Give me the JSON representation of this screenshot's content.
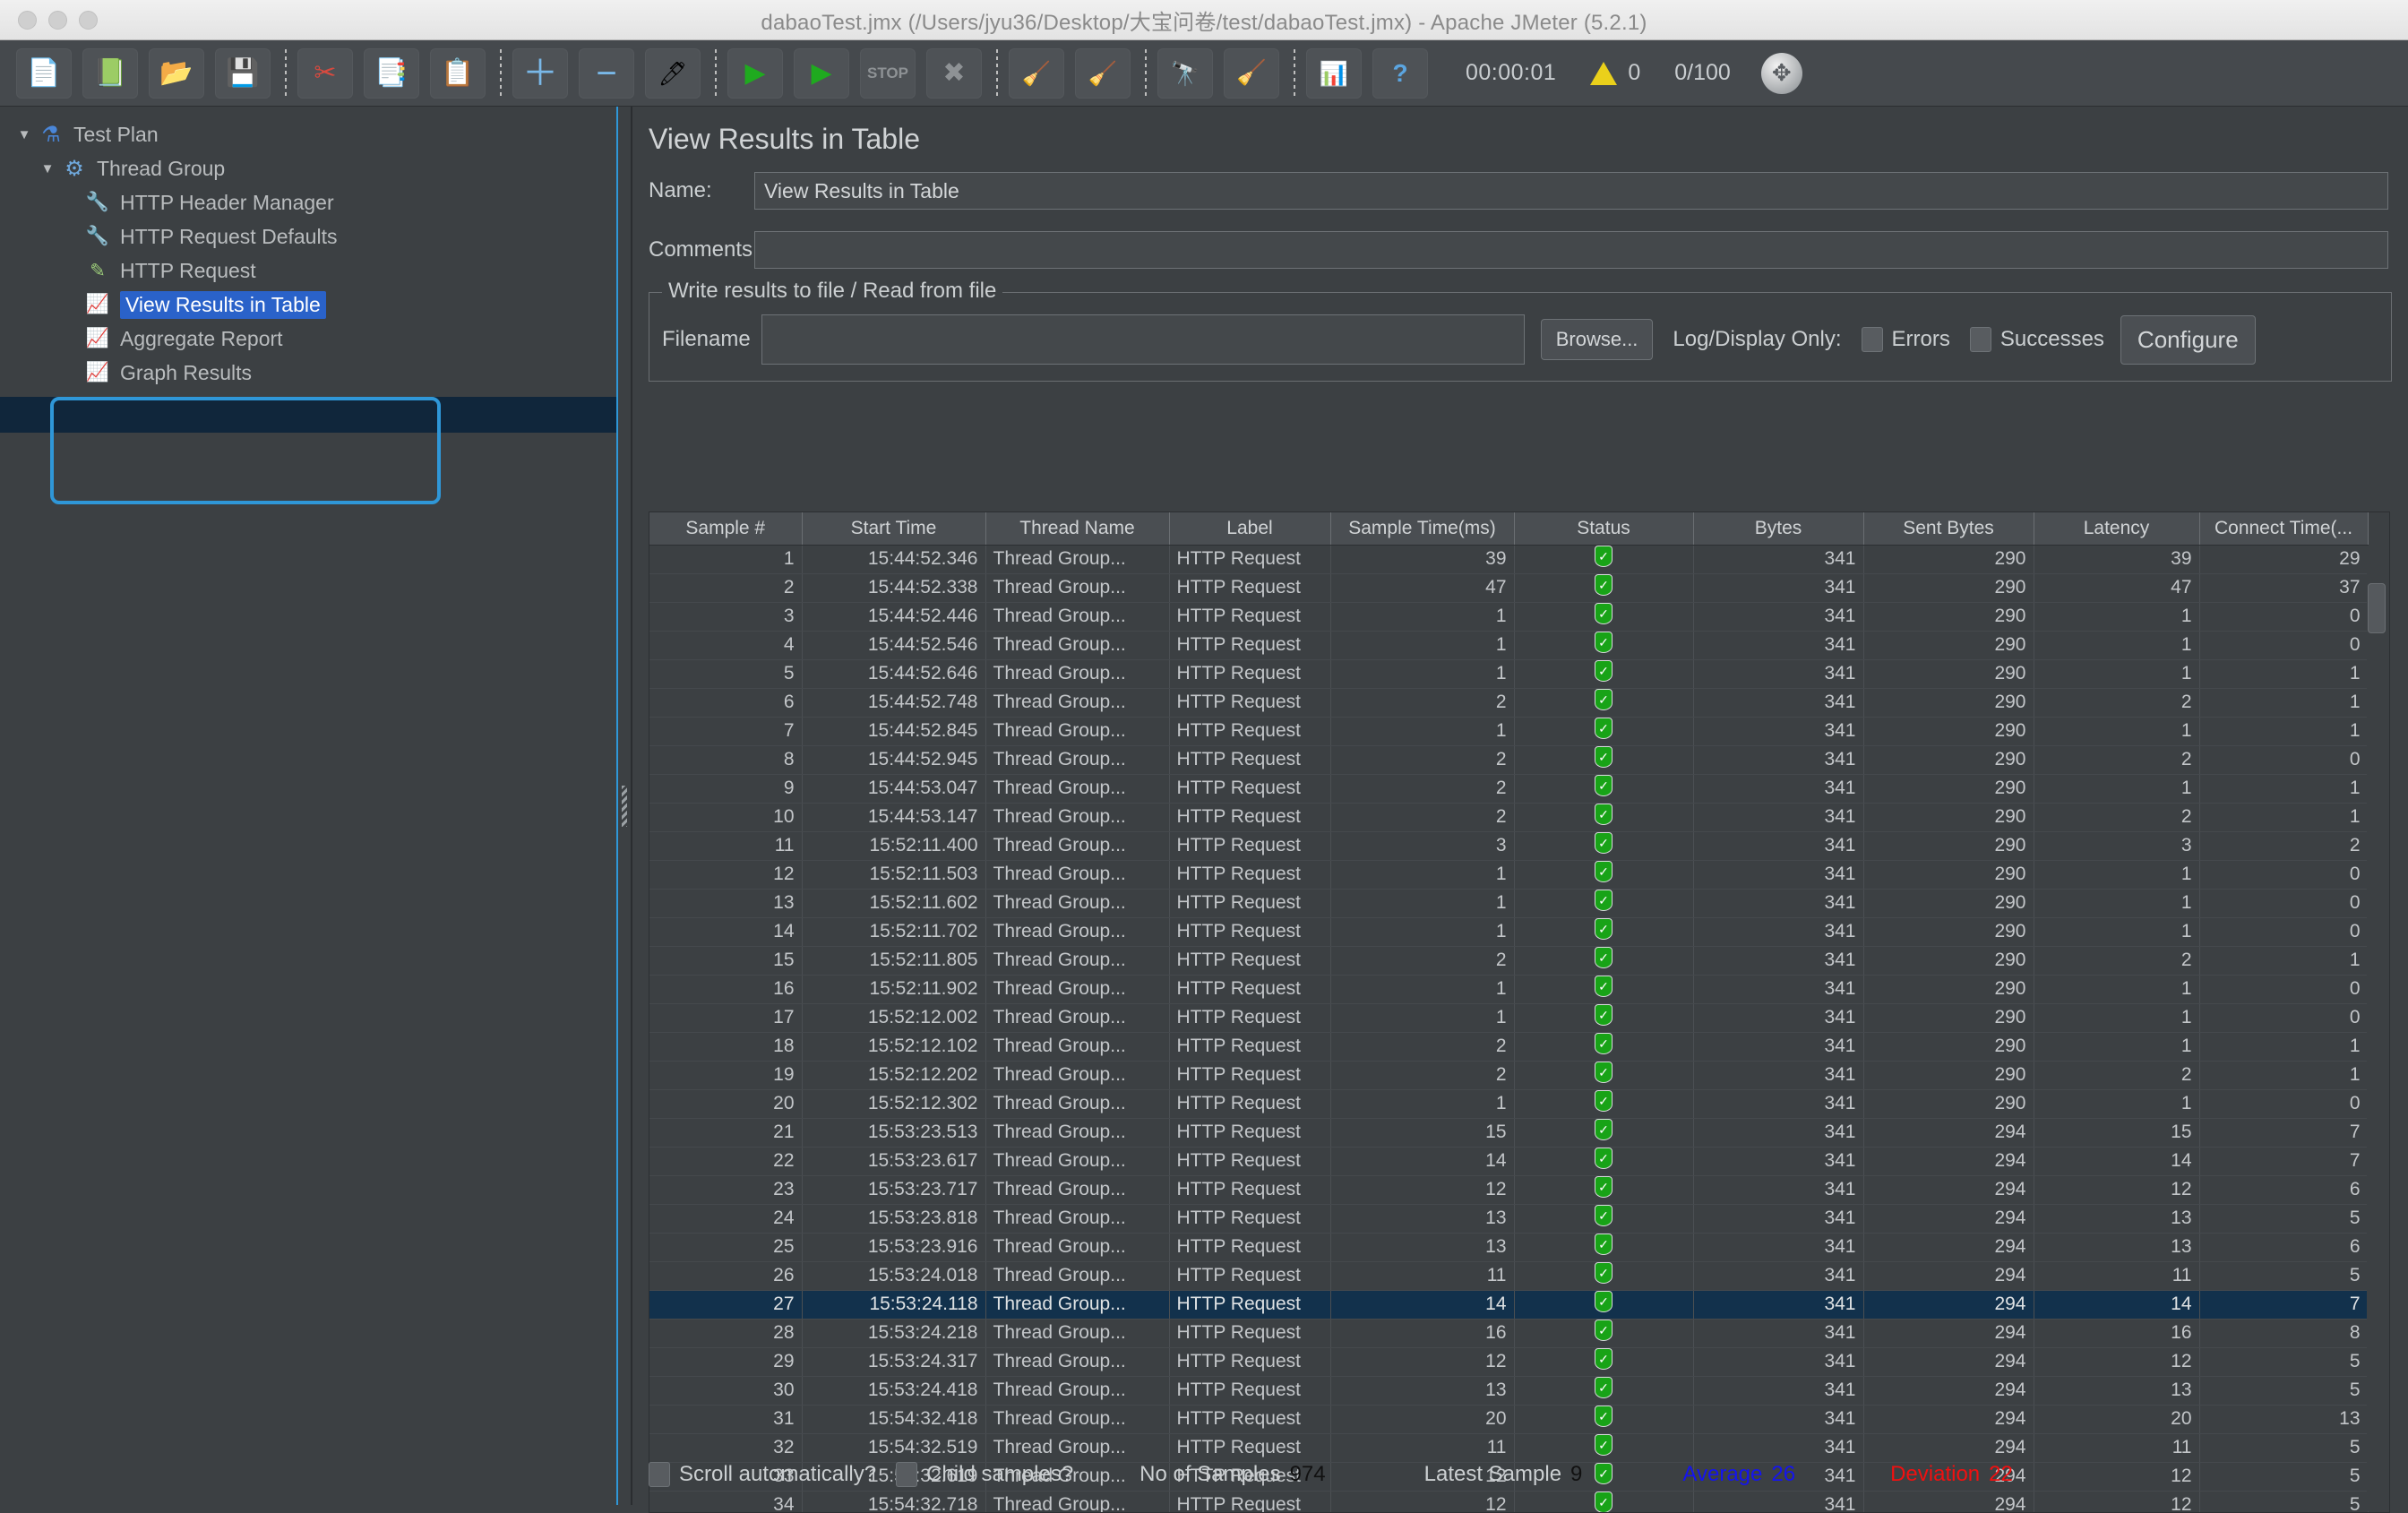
{
  "window": {
    "title": "dabaoTest.jmx (/Users/jyu36/Desktop/大宝问卷/test/dabaoTest.jmx) - Apache JMeter (5.2.1)"
  },
  "toolbar": {
    "buttons": [
      {
        "name": "new-test-plan",
        "icon": "📄",
        "label": "New"
      },
      {
        "name": "templates",
        "icon": "📗",
        "label": "Templates"
      },
      {
        "name": "open",
        "icon": "📂",
        "label": "Open"
      },
      {
        "name": "save",
        "icon": "💾",
        "label": "Save"
      },
      {
        "name": "cut",
        "icon": "✂",
        "label": "Cut"
      },
      {
        "name": "copy",
        "icon": "📑",
        "label": "Copy"
      },
      {
        "name": "paste",
        "icon": "📋",
        "label": "Paste"
      },
      {
        "name": "expand-all",
        "icon": "＋",
        "label": "Expand All"
      },
      {
        "name": "collapse-all",
        "icon": "−",
        "label": "Collapse All"
      },
      {
        "name": "toggle",
        "icon": "🖊",
        "label": "Toggle"
      },
      {
        "name": "start",
        "icon": "▶",
        "label": "Start"
      },
      {
        "name": "start-no-pauses",
        "icon": "▶",
        "label": "Start no pauses"
      },
      {
        "name": "stop",
        "icon": "STOP",
        "label": "Stop"
      },
      {
        "name": "shutdown",
        "icon": "✖",
        "label": "Shutdown"
      },
      {
        "name": "clear",
        "icon": "🧹",
        "label": "Clear"
      },
      {
        "name": "clear-all",
        "icon": "🧹",
        "label": "Clear All"
      },
      {
        "name": "search",
        "icon": "🔭",
        "label": "Search"
      },
      {
        "name": "reset-search",
        "icon": "🧹",
        "label": "Reset Search"
      },
      {
        "name": "function-helper",
        "icon": "📑",
        "label": "Function Helper Dialog"
      },
      {
        "name": "help",
        "icon": "?",
        "label": "Help"
      }
    ],
    "elapsed_time": "00:00:01",
    "warning_count": "0",
    "thread_counter": "0/100"
  },
  "tree": {
    "items": [
      {
        "label": "Test Plan",
        "icon": "flask-icon",
        "depth": 0,
        "expanded": true,
        "selected": false
      },
      {
        "label": "Thread Group",
        "icon": "gear-icon",
        "depth": 1,
        "expanded": true,
        "selected": false
      },
      {
        "label": "HTTP Header Manager",
        "icon": "tools-icon",
        "depth": 2,
        "expanded": false,
        "selected": false
      },
      {
        "label": "HTTP Request Defaults",
        "icon": "tools-icon",
        "depth": 2,
        "expanded": false,
        "selected": false
      },
      {
        "label": "HTTP Request",
        "icon": "pencil-icon",
        "depth": 2,
        "expanded": false,
        "selected": false
      },
      {
        "label": "View Results in Table",
        "icon": "chart-icon",
        "depth": 2,
        "expanded": false,
        "selected": true
      },
      {
        "label": "Aggregate Report",
        "icon": "chart-icon",
        "depth": 2,
        "expanded": false,
        "selected": false
      },
      {
        "label": "Graph Results",
        "icon": "chart-icon",
        "depth": 2,
        "expanded": false,
        "selected": false
      }
    ]
  },
  "panel": {
    "title": "View Results in Table",
    "name_label": "Name:",
    "name_value": "View Results in Table",
    "comments_label": "Comments:",
    "comments_value": "",
    "group_legend": "Write results to file / Read from file",
    "filename_label": "Filename",
    "filename_value": "",
    "browse_label": "Browse...",
    "log_display_label": "Log/Display Only:",
    "errors_label": "Errors",
    "successes_label": "Successes",
    "configure_label": "Configure"
  },
  "table": {
    "columns": [
      "Sample #",
      "Start Time",
      "Thread Name",
      "Label",
      "Sample Time(ms)",
      "Status",
      "Bytes",
      "Sent Bytes",
      "Latency",
      "Connect Time(..."
    ],
    "rows": [
      {
        "sample": "1",
        "start": "15:44:52.346",
        "thread": "Thread Group...",
        "label": "HTTP Request",
        "time": "39",
        "status": "ok",
        "bytes": "341",
        "sent": "290",
        "latency": "39",
        "connect": "29",
        "selected": false
      },
      {
        "sample": "2",
        "start": "15:44:52.338",
        "thread": "Thread Group...",
        "label": "HTTP Request",
        "time": "47",
        "status": "ok",
        "bytes": "341",
        "sent": "290",
        "latency": "47",
        "connect": "37",
        "selected": false
      },
      {
        "sample": "3",
        "start": "15:44:52.446",
        "thread": "Thread Group...",
        "label": "HTTP Request",
        "time": "1",
        "status": "ok",
        "bytes": "341",
        "sent": "290",
        "latency": "1",
        "connect": "0",
        "selected": false
      },
      {
        "sample": "4",
        "start": "15:44:52.546",
        "thread": "Thread Group...",
        "label": "HTTP Request",
        "time": "1",
        "status": "ok",
        "bytes": "341",
        "sent": "290",
        "latency": "1",
        "connect": "0",
        "selected": false
      },
      {
        "sample": "5",
        "start": "15:44:52.646",
        "thread": "Thread Group...",
        "label": "HTTP Request",
        "time": "1",
        "status": "ok",
        "bytes": "341",
        "sent": "290",
        "latency": "1",
        "connect": "1",
        "selected": false
      },
      {
        "sample": "6",
        "start": "15:44:52.748",
        "thread": "Thread Group...",
        "label": "HTTP Request",
        "time": "2",
        "status": "ok",
        "bytes": "341",
        "sent": "290",
        "latency": "2",
        "connect": "1",
        "selected": false
      },
      {
        "sample": "7",
        "start": "15:44:52.845",
        "thread": "Thread Group...",
        "label": "HTTP Request",
        "time": "1",
        "status": "ok",
        "bytes": "341",
        "sent": "290",
        "latency": "1",
        "connect": "1",
        "selected": false
      },
      {
        "sample": "8",
        "start": "15:44:52.945",
        "thread": "Thread Group...",
        "label": "HTTP Request",
        "time": "2",
        "status": "ok",
        "bytes": "341",
        "sent": "290",
        "latency": "2",
        "connect": "0",
        "selected": false
      },
      {
        "sample": "9",
        "start": "15:44:53.047",
        "thread": "Thread Group...",
        "label": "HTTP Request",
        "time": "2",
        "status": "ok",
        "bytes": "341",
        "sent": "290",
        "latency": "1",
        "connect": "1",
        "selected": false
      },
      {
        "sample": "10",
        "start": "15:44:53.147",
        "thread": "Thread Group...",
        "label": "HTTP Request",
        "time": "2",
        "status": "ok",
        "bytes": "341",
        "sent": "290",
        "latency": "2",
        "connect": "1",
        "selected": false
      },
      {
        "sample": "11",
        "start": "15:52:11.400",
        "thread": "Thread Group...",
        "label": "HTTP Request",
        "time": "3",
        "status": "ok",
        "bytes": "341",
        "sent": "290",
        "latency": "3",
        "connect": "2",
        "selected": false
      },
      {
        "sample": "12",
        "start": "15:52:11.503",
        "thread": "Thread Group...",
        "label": "HTTP Request",
        "time": "1",
        "status": "ok",
        "bytes": "341",
        "sent": "290",
        "latency": "1",
        "connect": "0",
        "selected": false
      },
      {
        "sample": "13",
        "start": "15:52:11.602",
        "thread": "Thread Group...",
        "label": "HTTP Request",
        "time": "1",
        "status": "ok",
        "bytes": "341",
        "sent": "290",
        "latency": "1",
        "connect": "0",
        "selected": false
      },
      {
        "sample": "14",
        "start": "15:52:11.702",
        "thread": "Thread Group...",
        "label": "HTTP Request",
        "time": "1",
        "status": "ok",
        "bytes": "341",
        "sent": "290",
        "latency": "1",
        "connect": "0",
        "selected": false
      },
      {
        "sample": "15",
        "start": "15:52:11.805",
        "thread": "Thread Group...",
        "label": "HTTP Request",
        "time": "2",
        "status": "ok",
        "bytes": "341",
        "sent": "290",
        "latency": "2",
        "connect": "1",
        "selected": false
      },
      {
        "sample": "16",
        "start": "15:52:11.902",
        "thread": "Thread Group...",
        "label": "HTTP Request",
        "time": "1",
        "status": "ok",
        "bytes": "341",
        "sent": "290",
        "latency": "1",
        "connect": "0",
        "selected": false
      },
      {
        "sample": "17",
        "start": "15:52:12.002",
        "thread": "Thread Group...",
        "label": "HTTP Request",
        "time": "1",
        "status": "ok",
        "bytes": "341",
        "sent": "290",
        "latency": "1",
        "connect": "0",
        "selected": false
      },
      {
        "sample": "18",
        "start": "15:52:12.102",
        "thread": "Thread Group...",
        "label": "HTTP Request",
        "time": "2",
        "status": "ok",
        "bytes": "341",
        "sent": "290",
        "latency": "1",
        "connect": "1",
        "selected": false
      },
      {
        "sample": "19",
        "start": "15:52:12.202",
        "thread": "Thread Group...",
        "label": "HTTP Request",
        "time": "2",
        "status": "ok",
        "bytes": "341",
        "sent": "290",
        "latency": "2",
        "connect": "1",
        "selected": false
      },
      {
        "sample": "20",
        "start": "15:52:12.302",
        "thread": "Thread Group...",
        "label": "HTTP Request",
        "time": "1",
        "status": "ok",
        "bytes": "341",
        "sent": "290",
        "latency": "1",
        "connect": "0",
        "selected": false
      },
      {
        "sample": "21",
        "start": "15:53:23.513",
        "thread": "Thread Group...",
        "label": "HTTP Request",
        "time": "15",
        "status": "ok",
        "bytes": "341",
        "sent": "294",
        "latency": "15",
        "connect": "7",
        "selected": false
      },
      {
        "sample": "22",
        "start": "15:53:23.617",
        "thread": "Thread Group...",
        "label": "HTTP Request",
        "time": "14",
        "status": "ok",
        "bytes": "341",
        "sent": "294",
        "latency": "14",
        "connect": "7",
        "selected": false
      },
      {
        "sample": "23",
        "start": "15:53:23.717",
        "thread": "Thread Group...",
        "label": "HTTP Request",
        "time": "12",
        "status": "ok",
        "bytes": "341",
        "sent": "294",
        "latency": "12",
        "connect": "6",
        "selected": false
      },
      {
        "sample": "24",
        "start": "15:53:23.818",
        "thread": "Thread Group...",
        "label": "HTTP Request",
        "time": "13",
        "status": "ok",
        "bytes": "341",
        "sent": "294",
        "latency": "13",
        "connect": "5",
        "selected": false
      },
      {
        "sample": "25",
        "start": "15:53:23.916",
        "thread": "Thread Group...",
        "label": "HTTP Request",
        "time": "13",
        "status": "ok",
        "bytes": "341",
        "sent": "294",
        "latency": "13",
        "connect": "6",
        "selected": false
      },
      {
        "sample": "26",
        "start": "15:53:24.018",
        "thread": "Thread Group...",
        "label": "HTTP Request",
        "time": "11",
        "status": "ok",
        "bytes": "341",
        "sent": "294",
        "latency": "11",
        "connect": "5",
        "selected": false
      },
      {
        "sample": "27",
        "start": "15:53:24.118",
        "thread": "Thread Group...",
        "label": "HTTP Request",
        "time": "14",
        "status": "ok",
        "bytes": "341",
        "sent": "294",
        "latency": "14",
        "connect": "7",
        "selected": true
      },
      {
        "sample": "28",
        "start": "15:53:24.218",
        "thread": "Thread Group...",
        "label": "HTTP Request",
        "time": "16",
        "status": "ok",
        "bytes": "341",
        "sent": "294",
        "latency": "16",
        "connect": "8",
        "selected": false
      },
      {
        "sample": "29",
        "start": "15:53:24.317",
        "thread": "Thread Group...",
        "label": "HTTP Request",
        "time": "12",
        "status": "ok",
        "bytes": "341",
        "sent": "294",
        "latency": "12",
        "connect": "5",
        "selected": false
      },
      {
        "sample": "30",
        "start": "15:53:24.418",
        "thread": "Thread Group...",
        "label": "HTTP Request",
        "time": "13",
        "status": "ok",
        "bytes": "341",
        "sent": "294",
        "latency": "13",
        "connect": "5",
        "selected": false
      },
      {
        "sample": "31",
        "start": "15:54:32.418",
        "thread": "Thread Group...",
        "label": "HTTP Request",
        "time": "20",
        "status": "ok",
        "bytes": "341",
        "sent": "294",
        "latency": "20",
        "connect": "13",
        "selected": false
      },
      {
        "sample": "32",
        "start": "15:54:32.519",
        "thread": "Thread Group...",
        "label": "HTTP Request",
        "time": "11",
        "status": "ok",
        "bytes": "341",
        "sent": "294",
        "latency": "11",
        "connect": "5",
        "selected": false
      },
      {
        "sample": "33",
        "start": "15:54:32.619",
        "thread": "Thread Group...",
        "label": "HTTP Request",
        "time": "12",
        "status": "ok",
        "bytes": "341",
        "sent": "294",
        "latency": "12",
        "connect": "5",
        "selected": false
      },
      {
        "sample": "34",
        "start": "15:54:32.718",
        "thread": "Thread Group...",
        "label": "HTTP Request",
        "time": "12",
        "status": "ok",
        "bytes": "341",
        "sent": "294",
        "latency": "12",
        "connect": "5",
        "selected": false
      }
    ]
  },
  "statusbar": {
    "scroll_label": "Scroll automatically?",
    "child_label": "Child samples?",
    "no_of_samples_label": "No of Samples",
    "no_of_samples_value": "974",
    "latest_sample_label": "Latest Sample",
    "latest_sample_value": "9",
    "average_label": "Average",
    "average_value": "26",
    "deviation_label": "Deviation",
    "deviation_value": "22"
  },
  "colors": {
    "accent_blue": "#2f97d8",
    "selection_blue": "#2a62c9",
    "row_selection": "#12314c",
    "success_green": "#18a317",
    "average_blue": "#1414ef",
    "deviation_red": "#f01010",
    "warning_yellow": "#ead01b"
  }
}
